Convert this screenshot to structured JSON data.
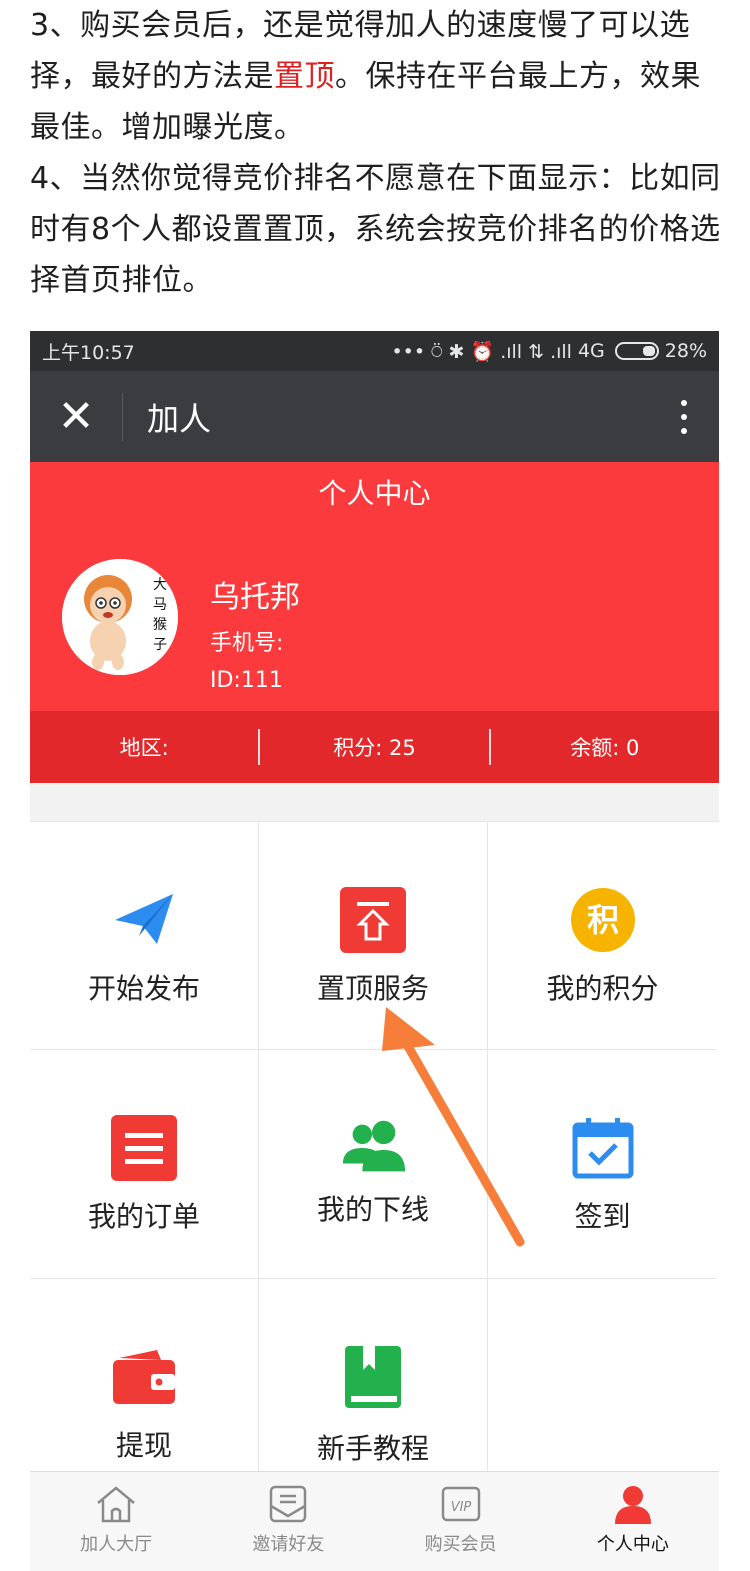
{
  "article": {
    "p3_before": "3、购买会员后，还是觉得加人的速度慢了可以选择，最好的方法是",
    "p3_highlight": "置顶",
    "p3_after": "。保持在平台最上方，效果最佳。增加曝光度。",
    "p4": "4、当然你觉得竞价排名不愿意在下面显示：比如同时有8个人都设置置顶，系统会按竞价排名的价格选择首页排位。"
  },
  "statusbar": {
    "time": "上午10:57",
    "icons": "••• ⍥ ✱ ⏰ .ıll ⇅ .ıll",
    "network": "4G",
    "battery": "28%"
  },
  "navbar": {
    "close_icon": "✕",
    "title": "加人"
  },
  "profile": {
    "header_title": "个人中心",
    "username": "乌托邦",
    "phone_label": "手机号:",
    "user_id": "ID:111",
    "avatar_text": "大马猴子"
  },
  "stats": {
    "region": "地区:",
    "points": "积分: 25",
    "balance": "余额: 0"
  },
  "grid": {
    "items": [
      {
        "label": "开始发布",
        "icon": "paper-plane"
      },
      {
        "label": "置顶服务",
        "icon": "pin-top"
      },
      {
        "label": "我的积分",
        "icon": "points",
        "icon_text": "积"
      },
      {
        "label": "我的订单",
        "icon": "order-list"
      },
      {
        "label": "我的下线",
        "icon": "users"
      },
      {
        "label": "签到",
        "icon": "calendar-check"
      },
      {
        "label": "提现",
        "icon": "wallet"
      },
      {
        "label": "新手教程",
        "icon": "book"
      }
    ]
  },
  "tabbar": {
    "items": [
      {
        "label": "加人大厅",
        "icon": "home"
      },
      {
        "label": "邀请好友",
        "icon": "envelope"
      },
      {
        "label": "购买会员",
        "icon": "vip",
        "icon_text": "VIP"
      },
      {
        "label": "个人中心",
        "icon": "person",
        "active": true
      }
    ]
  },
  "colors": {
    "brand_red": "#fb3a3d",
    "stats_red": "#e3282b",
    "nav_dark": "#3b3c3f",
    "status_dark": "#2e2f31",
    "blue": "#2d8cf0",
    "green": "#23b14d",
    "yellow": "#f6b400",
    "arrow_orange": "#f77e3a"
  }
}
